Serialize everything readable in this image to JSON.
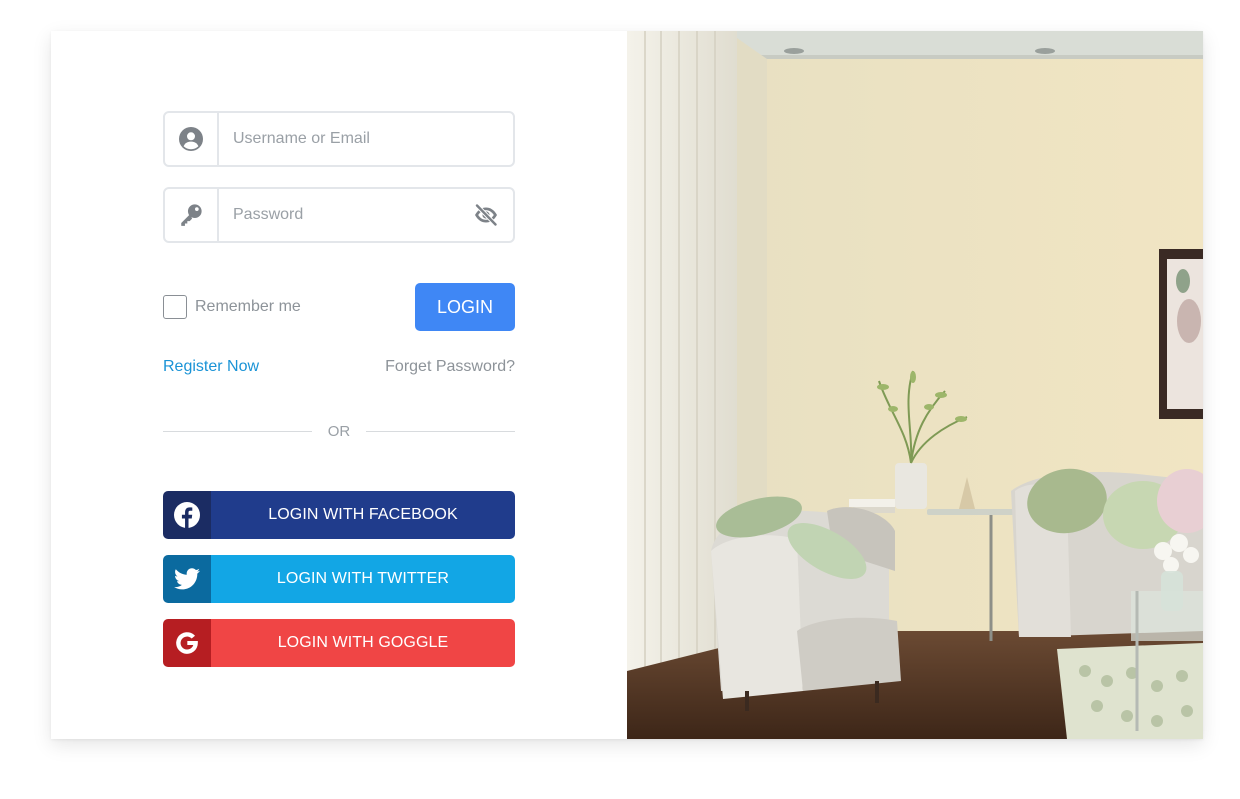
{
  "form": {
    "username_placeholder": "Username or Email",
    "password_placeholder": "Password",
    "remember_label": "Remember me",
    "login_label": "LOGIN",
    "register_link": "Register Now",
    "forget_link": "Forget Password?",
    "divider_text": "OR"
  },
  "social": {
    "facebook_label": "LOGIN WITH FACEBOOK",
    "twitter_label": "LOGIN WITH TWITTER",
    "google_label": "LOGIN WITH GOGGLE"
  },
  "icons": {
    "user": "user-circle-icon",
    "password": "key-icon",
    "toggle_visibility": "eye-slash-icon",
    "facebook": "facebook-icon",
    "twitter": "twitter-icon",
    "google": "google-icon"
  },
  "colors": {
    "primary": "#3f87f5",
    "link": "#1a93d6",
    "facebook_dark": "#1b2c63",
    "facebook": "#203c8c",
    "twitter_dark": "#0b6a9f",
    "twitter": "#12a6e5",
    "google_dark": "#b61e22",
    "google": "#f04545"
  }
}
